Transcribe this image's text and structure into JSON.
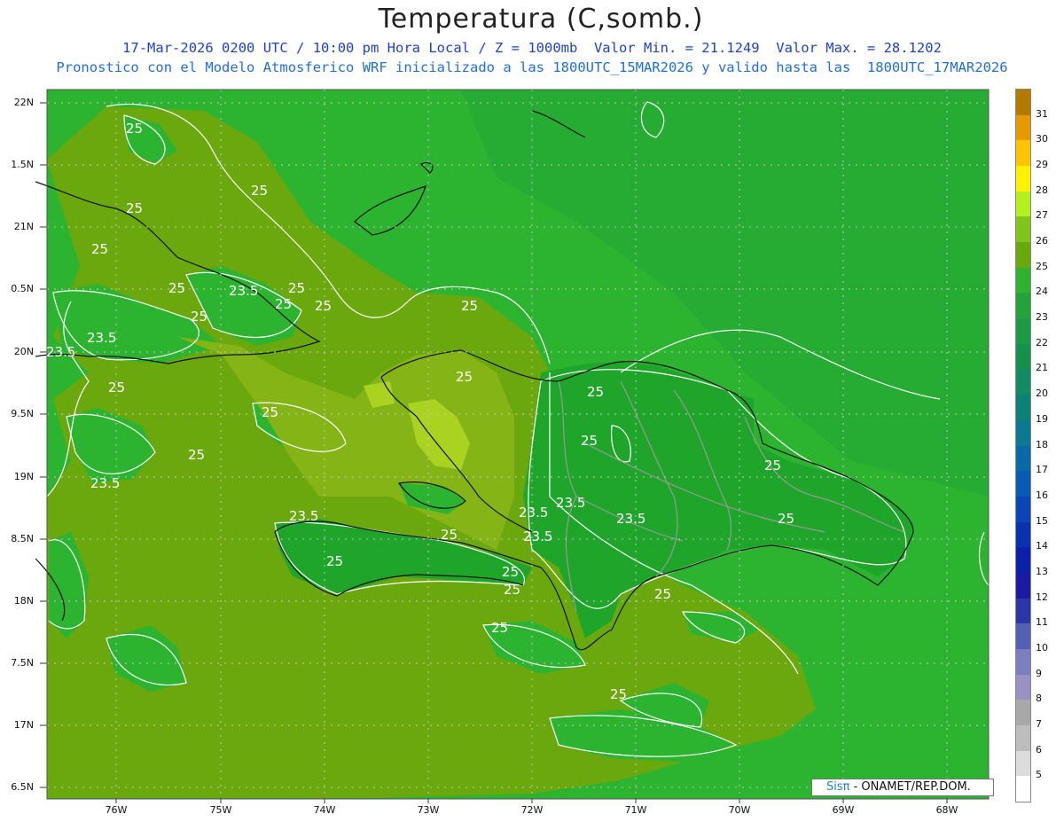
{
  "header": {
    "title": "Temperatura (C,somb.)",
    "subtitle_line1": "17-Mar-2026 0200 UTC / 10:00 pm Hora Local / Z = 1000mb  Valor Min. = 21.1249  Valor Max. = 28.1202",
    "subtitle_line2": "Pronostico con el Modelo Atmosferico WRF inicializado a las 1800UTC_15MAR2026 y valido hasta las  1800UTC_17MAR2026"
  },
  "map": {
    "lat_ticks": [
      "22N",
      "1.5N",
      "21N",
      "0.5N",
      "20N",
      "9.5N",
      "19N",
      "8.5N",
      "18N",
      "7.5N",
      "17N",
      "6.5N"
    ],
    "lon_ticks": [
      "76W",
      "75W",
      "74W",
      "73W",
      "72W",
      "71W",
      "70W",
      "69W",
      "68W"
    ],
    "contour_labels": [
      "25",
      "25",
      "25",
      "25",
      "25",
      "23.5",
      "25",
      "25",
      "25",
      "23.5",
      "23.5",
      "25",
      "25",
      "25",
      "25",
      "25",
      "23.5",
      "25",
      "25",
      "25",
      "25",
      "23.5",
      "23.5",
      "23.5",
      "23.5",
      "23.5",
      "25",
      "25",
      "25",
      "25",
      "25",
      "25",
      "25",
      "25"
    ],
    "colors": {
      "c23": "#1fa62a",
      "c24": "#2cb431",
      "c25": "#6aa80e",
      "c26": "#84b416",
      "c27": "#aad321",
      "ocean_deep": "#2fb534"
    }
  },
  "colorbar": {
    "labels": [
      "31",
      "30",
      "29",
      "28",
      "27",
      "26",
      "25",
      "24",
      "23",
      "22",
      "21",
      "20",
      "19",
      "18",
      "17",
      "16",
      "15",
      "14",
      "13",
      "12",
      "11",
      "10",
      "9",
      "8",
      "7",
      "6",
      "5"
    ],
    "colors": [
      "#b37a00",
      "#e69a00",
      "#ffc400",
      "#fff200",
      "#b4f01e",
      "#82c41a",
      "#6aa80e",
      "#2fb232",
      "#25a23a",
      "#1d9a46",
      "#17904e",
      "#138a63",
      "#0d8078",
      "#0c7891",
      "#0a6aa8",
      "#095ab5",
      "#0a46b8",
      "#0a32b0",
      "#0c1fa8",
      "#1a1aa3",
      "#2d36a6",
      "#5560b3",
      "#7a7fbf",
      "#9a90c4",
      "#a8a8a8",
      "#bdbdbd",
      "#dcdcdc",
      "#ffffff"
    ]
  },
  "credit": {
    "brand": "Sisπ",
    "text": " - ONAMET/REP.DOM."
  }
}
